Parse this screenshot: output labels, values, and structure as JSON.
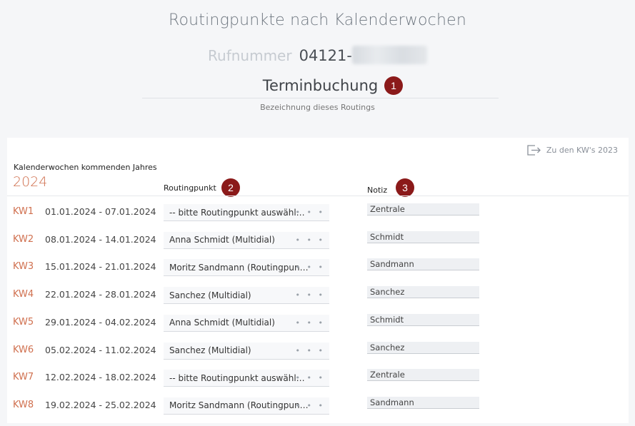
{
  "header": {
    "title": "Routingpunkte nach Kalenderwochen",
    "phone_label": "Rufnummer",
    "phone_number": "04121-",
    "routing_name": "Terminbuchung",
    "routing_caption": "Bezeichnung dieses Routings"
  },
  "badges": [
    "1",
    "2",
    "3"
  ],
  "panel": {
    "back_link": "Zu den KW's 2023",
    "year_caption": "Kalenderwochen kommenden Jahres",
    "year": "2024",
    "col_routing": "Routingpunkt",
    "col_note": "Notiz"
  },
  "weeks": [
    {
      "kw": "KW1",
      "range": "01.01.2024  -  07.01.2024",
      "routing": "-- bitte Routingpunkt auswählen --",
      "note": "Zentrale"
    },
    {
      "kw": "KW2",
      "range": "08.01.2024  -  14.01.2024",
      "routing": "Anna Schmidt (Multidial)",
      "note": "Schmidt"
    },
    {
      "kw": "KW3",
      "range": "15.01.2024  -  21.01.2024",
      "routing": "Moritz Sandmann (Routingpunkt Einzelruf)",
      "note": "Sandmann"
    },
    {
      "kw": "KW4",
      "range": "22.01.2024  -  28.01.2024",
      "routing": "Sanchez (Multidial)",
      "note": "Sanchez"
    },
    {
      "kw": "KW5",
      "range": "29.01.2024  -  04.02.2024",
      "routing": "Anna Schmidt (Multidial)",
      "note": "Schmidt"
    },
    {
      "kw": "KW6",
      "range": "05.02.2024  -  11.02.2024",
      "routing": "Sanchez (Multidial)",
      "note": "Sanchez"
    },
    {
      "kw": "KW7",
      "range": "12.02.2024  -  18.02.2024",
      "routing": "-- bitte Routingpunkt auswählen --",
      "note": "Zentrale"
    },
    {
      "kw": "KW8",
      "range": "19.02.2024  -  25.02.2024",
      "routing": "Moritz Sandmann (Routingpunkt Einzelruf)",
      "note": "Sandmann"
    }
  ],
  "more_icon": "• • •",
  "colors": {
    "accent": "#d0704f",
    "badge": "#8b1a1a"
  }
}
